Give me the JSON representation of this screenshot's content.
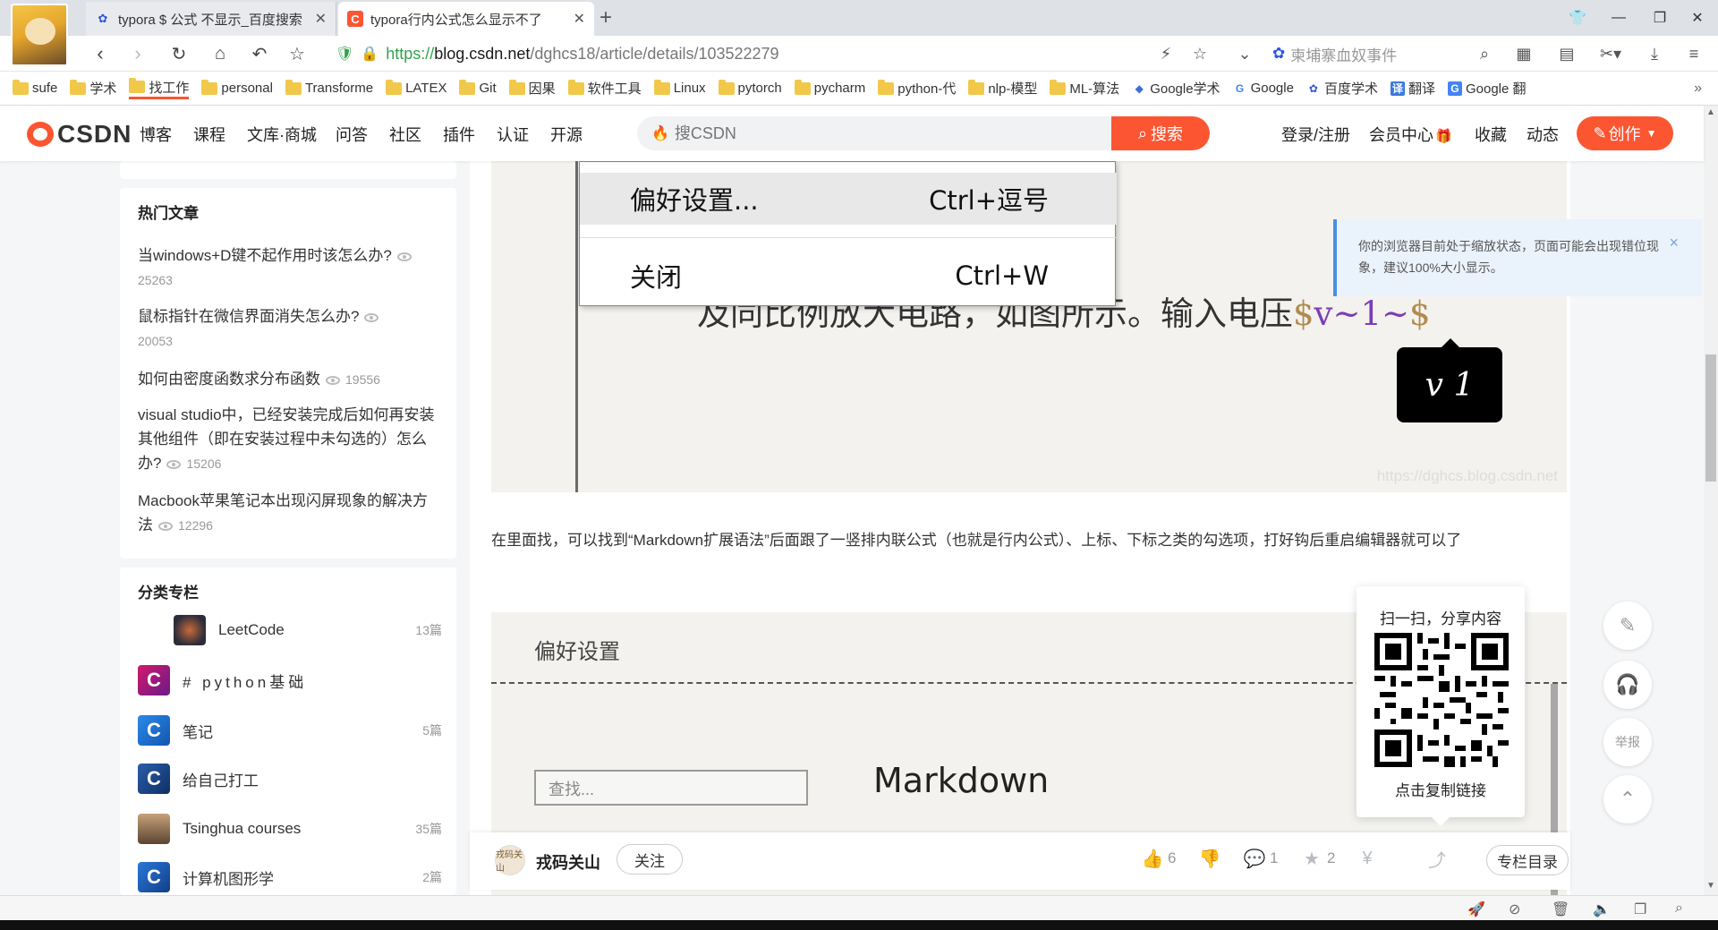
{
  "browser": {
    "tabs": [
      {
        "title": "typora $ 公式 不显示_百度搜索",
        "icon": "baidu-paw-icon",
        "active": false
      },
      {
        "title": "typora行内公式怎么显示不了",
        "icon": "csdn-c-icon",
        "active": true
      }
    ],
    "new_tab": "+",
    "url": {
      "scheme": "https://",
      "host": "blog.csdn.net",
      "path": "/dghcs18/article/details/103522279"
    },
    "search_box": "柬埔寨血奴事件",
    "bookmarks": [
      "sufe",
      "学术",
      "找工作",
      "personal",
      "Transforme",
      "LATEX",
      "Git",
      "因果",
      "软件工具",
      "Linux",
      "pytorch",
      "pycharm",
      "python-代",
      "nlp-模型",
      "ML-算法",
      "Google学术",
      "Google",
      "百度学术",
      "翻译",
      "Google 翻"
    ],
    "bookmark_more": "»"
  },
  "csdn": {
    "logo": "CSDN",
    "nav": [
      "博客",
      "课程",
      "文库·商城",
      "问答",
      "社区",
      "插件",
      "认证",
      "开源"
    ],
    "search_placeholder": "搜CSDN",
    "search_button": "搜索",
    "login": "登录/注册",
    "vip": "会员中心",
    "favorites": "收藏",
    "dynamic": "动态",
    "create": "创作"
  },
  "sidebar": {
    "hot_title": "热门文章",
    "hot": [
      {
        "title": "当windows+D键不起作用时该怎么办?",
        "views": "25263"
      },
      {
        "title": "鼠标指针在微信界面消失怎么办?",
        "views": "20053"
      },
      {
        "title": "如何由密度函数求分布函数",
        "views": "19556"
      },
      {
        "title": "visual studio中，已经安装完成后如何再安装其他组件（即在安装过程中未勾选的）怎么办?",
        "views": "15206"
      },
      {
        "title": "Macbook苹果笔记本出现闪屏现象的解决方法",
        "views": "12296"
      }
    ],
    "columns_title": "分类专栏",
    "columns": [
      {
        "name": "LeetCode",
        "count": "13篇",
        "color": "#3b3b4f"
      },
      {
        "name": "#  python基础",
        "count": "",
        "color": "#b51a5a"
      },
      {
        "name": "笔记",
        "count": "5篇",
        "color": "#1c73d9"
      },
      {
        "name": "给自己打工",
        "count": "",
        "color": "#1e4f8f"
      },
      {
        "name": "Tsinghua courses",
        "count": "35篇",
        "color": "#7a5a3a"
      },
      {
        "name": "计算机图形学",
        "count": "2篇",
        "color": "#1f5fae"
      }
    ]
  },
  "article": {
    "fig1": {
      "menu_items": [
        {
          "label": "偏好设置...",
          "shortcut": "Ctrl+逗号"
        },
        {
          "label": "关闭",
          "shortcut": "Ctrl+W"
        }
      ],
      "body_text": "及同比例放大电路，如图所示。输入电压",
      "math_open": "$",
      "math_inner": "v~1~",
      "math_close": "$",
      "tooltip": "v 1",
      "watermark": "https://dghcs.blog.csdn.net"
    },
    "paragraph": "在里面找，可以找到“Markdown扩展语法”后面跟了一竖排内联公式（也就是行内公式）、上标、下标之类的勾选项，打好钩后重启编辑器就可以了",
    "fig2": {
      "title": "偏好设置",
      "find_placeholder": "查找...",
      "section": "Markdown"
    }
  },
  "share_popup": {
    "title": "扫一扫，分享内容",
    "link": "点击复制链接"
  },
  "zoom_notice": {
    "text": "你的浏览器目前处于缩放状态，页面可能会出现错位现象，建议100%大小显示。",
    "close": "×"
  },
  "toolbar": {
    "author": "戎码关山",
    "author_avatar_text": "戎码关山",
    "follow": "关注",
    "likes": "6",
    "comments": "1",
    "favorites": "2",
    "toc": "专栏目录"
  },
  "float": {
    "report": "举报"
  },
  "colors": {
    "csdn_red": "#fc5531",
    "link_green": "#31a14b"
  }
}
